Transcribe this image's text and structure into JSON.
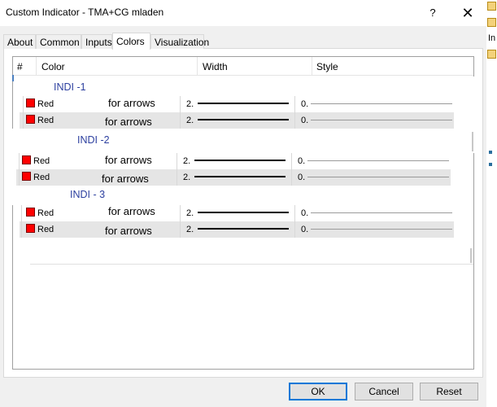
{
  "window": {
    "title": "Custom Indicator - TMA+CG mladen",
    "help_label": "?",
    "close_label": "✕"
  },
  "tabs": [
    {
      "label": "About"
    },
    {
      "label": "Common"
    },
    {
      "label": "Inputs"
    },
    {
      "label": "Colors",
      "active": true
    },
    {
      "label": "Visualization"
    }
  ],
  "grid": {
    "columns": [
      "#",
      "Color",
      "Width",
      "Style"
    ]
  },
  "groups": [
    {
      "label": "INDI -1",
      "rows": [
        {
          "color_name": "Red",
          "note": "for arrows",
          "width": "2.",
          "style": "0."
        },
        {
          "color_name": "Red",
          "note": "for arrows",
          "width": "2.",
          "style": "0."
        }
      ]
    },
    {
      "label": "INDI -2",
      "rows": [
        {
          "color_name": "Red",
          "note": "for arrows",
          "width": "2.",
          "style": "0."
        },
        {
          "color_name": "Red",
          "note": "for arrows",
          "width": "2.",
          "style": "0."
        }
      ]
    },
    {
      "label": "INDI - 3",
      "rows": [
        {
          "color_name": "Red",
          "note": "for arrows",
          "width": "2.",
          "style": "0."
        },
        {
          "color_name": "Red",
          "note": "for arrows",
          "width": "2.",
          "style": "0."
        }
      ]
    }
  ],
  "buttons": {
    "ok": "OK",
    "cancel": "Cancel",
    "reset": "Reset"
  },
  "background_app": {
    "text": "In"
  },
  "colors": {
    "swatch": "#ff0000",
    "label_blue": "#2c3f9f",
    "default_button_border": "#0078d7"
  }
}
